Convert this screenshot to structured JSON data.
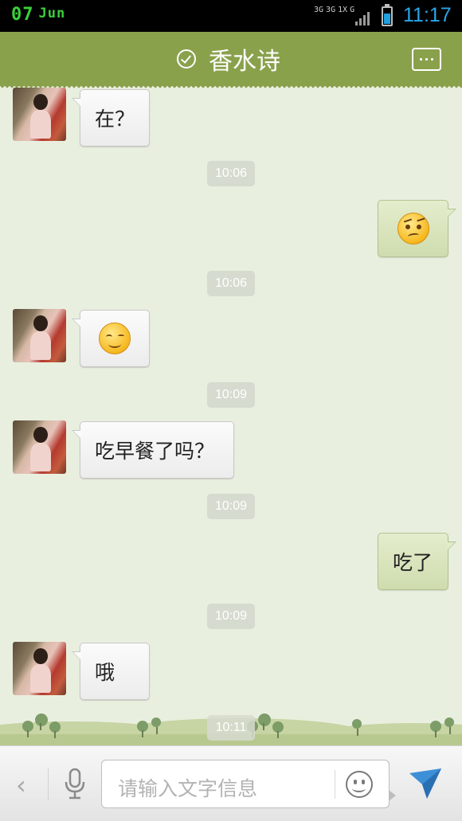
{
  "status_bar": {
    "day": "07",
    "month": "Jun",
    "network_top": [
      "3G",
      "3G",
      "1X",
      "G"
    ],
    "time": "11:17"
  },
  "header": {
    "title": "香水诗",
    "verified_icon": "check-circle-icon",
    "menu_icon": "more-dots-icon"
  },
  "messages": [
    {
      "type": "text",
      "direction": "incoming",
      "text": "在？"
    },
    {
      "type": "timestamp",
      "text": "10:06"
    },
    {
      "type": "emoji",
      "direction": "outgoing",
      "emoji": "worried-face-icon"
    },
    {
      "type": "timestamp",
      "text": "10:06"
    },
    {
      "type": "emoji",
      "direction": "incoming",
      "emoji": "smile-face-icon"
    },
    {
      "type": "timestamp",
      "text": "10:09"
    },
    {
      "type": "text",
      "direction": "incoming",
      "text": "吃早餐了吗？"
    },
    {
      "type": "timestamp",
      "text": "10:09"
    },
    {
      "type": "text",
      "direction": "outgoing",
      "text": "吃了"
    },
    {
      "type": "timestamp",
      "text": "10:09"
    },
    {
      "type": "text",
      "direction": "incoming",
      "text": "哦"
    },
    {
      "type": "timestamp",
      "text": "10:11"
    }
  ],
  "input_bar": {
    "placeholder": "请输入文字信息",
    "back_label": "‹",
    "icons": [
      "mic-icon",
      "emoji-icon",
      "send-icon"
    ]
  },
  "colors": {
    "header": "#8aa14c",
    "chat_background": "#e9efdf",
    "incoming_bubble": "#f4f4f4",
    "outgoing_bubble": "#d8e4bb",
    "timestamp": "#d6dbcf",
    "status_time": "#2aa6e8",
    "status_date": "#3ad13a"
  }
}
